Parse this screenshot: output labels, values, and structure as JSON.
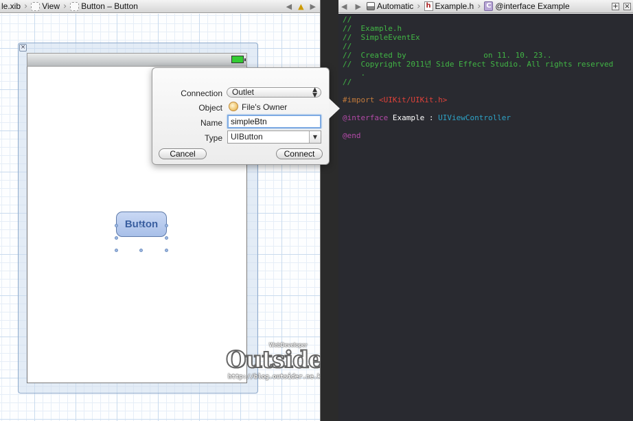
{
  "left_jumpbar": {
    "items": [
      "le.xib",
      "View",
      "Button – Button"
    ]
  },
  "right_jumpbar": {
    "back_arrow": "◀",
    "forward_arrow": "▶",
    "automatic": "Automatic",
    "file": "Example.h",
    "file_icon_letter": "h",
    "symbol": "@interface Example",
    "symbol_icon_letter": "C"
  },
  "canvas": {
    "button_label": "Button"
  },
  "connection_popover": {
    "connection_label": "Connection",
    "connection_value": "Outlet",
    "object_label": "Object",
    "object_value": "File's Owner",
    "name_label": "Name",
    "name_value": "simpleBtn",
    "type_label": "Type",
    "type_value": "UIButton",
    "cancel_label": "Cancel",
    "connect_label": "Connect"
  },
  "editor": {
    "lines": [
      "//",
      "//  Example.h",
      "//  SimpleEventEx",
      "//",
      "//  Created by                 on 11. 10. 23..",
      "//  Copyright 2011년 Side Effect Studio. All rights reserved",
      "    .",
      "//",
      "#import",
      "<UIKit/UIKit.h>",
      "@interface",
      "Example :",
      "UIViewController",
      "@end"
    ]
  },
  "watermark": {
    "title": "Outsider",
    "tagline": "WebDeveloper",
    "url": "http://blog.outsider.ne.kr"
  },
  "colors": {
    "editor_background": "#292a30",
    "comment": "#41b645",
    "keyword": "#b34aa8",
    "class_name": "#2ea3c7",
    "string": "#e0423a",
    "preprocessor": "#c27a3c",
    "selection_focus": "#7eabe3"
  }
}
